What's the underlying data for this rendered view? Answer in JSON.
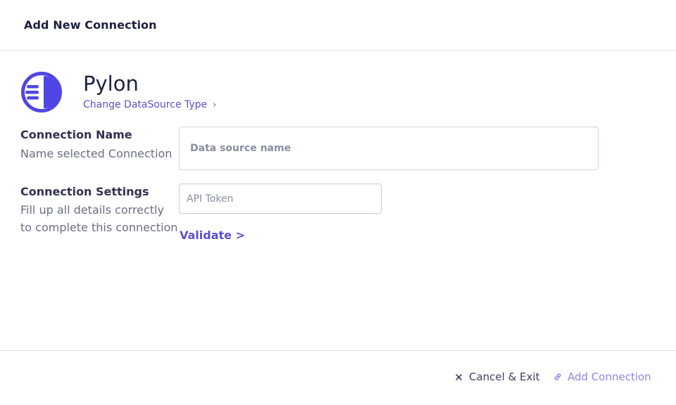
{
  "modal": {
    "title": "Add New Connection"
  },
  "datasource": {
    "name": "Pylon",
    "change_type_label": "Change DataSource Type",
    "change_type_icon": "chevron-right-icon",
    "brand_color": "#4f46e5"
  },
  "connection_name": {
    "title": "Connection Name",
    "description": "Name selected Connection",
    "input_placeholder": "Data source name",
    "input_value": ""
  },
  "connection_settings": {
    "title": "Connection Settings",
    "description": "Fill up all details correctly to complete this connection",
    "token_placeholder": "API Token",
    "token_value": "",
    "validate_label": "Validate >"
  },
  "footer": {
    "cancel_label": "Cancel & Exit",
    "cancel_icon": "close-icon",
    "add_label": "Add Connection",
    "add_icon": "link-icon"
  },
  "colors": {
    "accent": "#5b4fcf",
    "accent_disabled": "#8f86e3",
    "text_dark": "#1d2140",
    "text_muted": "#6b6f82"
  }
}
